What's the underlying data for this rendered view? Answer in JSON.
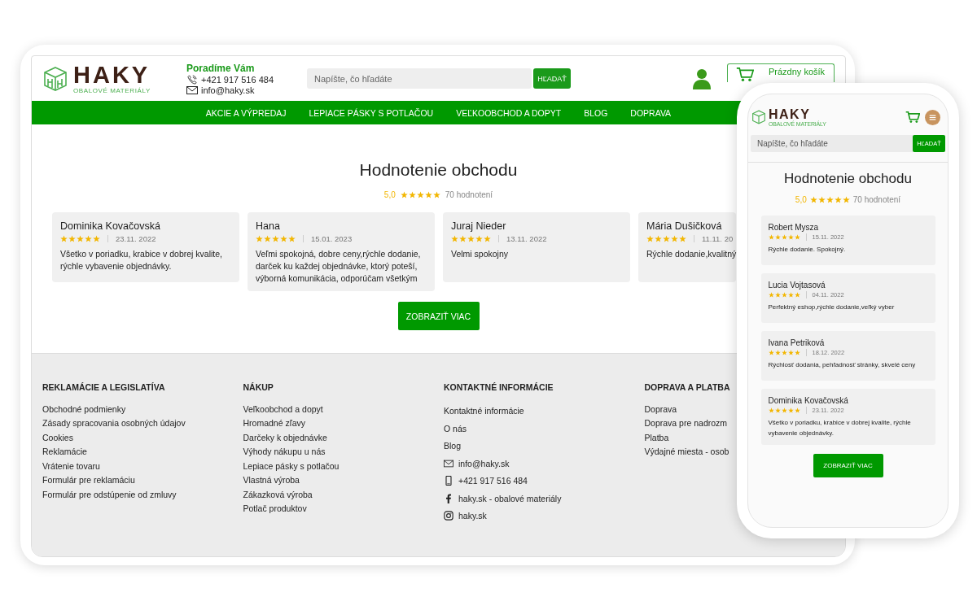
{
  "tablet": {
    "header": {
      "brand": "HAKY",
      "tagline": "OBALOVÉ MATERIÁLY",
      "help_title": "Poradíme Vám",
      "phone": "+421 917 516 484",
      "email": "info@haky.sk",
      "search_placeholder": "Napíšte, čo hľadáte",
      "search_button": "HĽADAŤ",
      "cart_label": "Prázdny košík"
    },
    "nav": [
      "AKCIE A VÝPREDAJ",
      "LEPIACE PÁSKY S POTLAČOU",
      "VEĽKOOBCHOD A DOPYT",
      "BLOG",
      "DOPRAVA"
    ],
    "reviews": {
      "title": "Hodnotenie obchodu",
      "score": "5,0",
      "stars": 5,
      "count": "70 hodnotení",
      "items": [
        {
          "name": "Dominika Kovačovská",
          "stars": 5,
          "date": "23.11. 2022",
          "text": "Všetko v poriadku, krabice v dobrej kvalite, rýchle vybavenie objednávky."
        },
        {
          "name": "Hana",
          "stars": 5,
          "date": "15.01. 2023",
          "text": "Veľmi spokojná, dobre ceny,rýchle dodanie, darček ku každej objednávke, ktorý poteší, výborná komunikácia, odporúčam všetkým"
        },
        {
          "name": "Juraj Nieder",
          "stars": 5,
          "date": "13.11. 2022",
          "text": "Velmi spokojny"
        },
        {
          "name": "Mária Dušičková",
          "stars": 5,
          "date": "11.11. 20",
          "text": "Rýchle dodanie,kvalitný"
        }
      ]
    },
    "more_button": "ZOBRAZIŤ VIAC",
    "footer": [
      {
        "heading": "REKLAMÁCIE A LEGISLATÍVA",
        "links": [
          {
            "kind": "plain",
            "text": "Obchodné podmienky"
          },
          {
            "kind": "plain",
            "text": "Zásady spracovania osobných údajov"
          },
          {
            "kind": "plain",
            "text": "Cookies"
          },
          {
            "kind": "plain",
            "text": "Reklamácie"
          },
          {
            "kind": "plain",
            "text": "Vrátenie tovaru"
          },
          {
            "kind": "plain",
            "text": "Formulár pre reklamáciu"
          },
          {
            "kind": "plain",
            "text": "Formulár pre odstúpenie od zmluvy"
          }
        ]
      },
      {
        "heading": "NÁKUP",
        "links": [
          {
            "kind": "plain",
            "text": "Veľkoobchod a dopyt"
          },
          {
            "kind": "plain",
            "text": "Hromadné zľavy"
          },
          {
            "kind": "plain",
            "text": "Darčeky k objednávke"
          },
          {
            "kind": "plain",
            "text": "Výhody nákupu u nás"
          },
          {
            "kind": "plain",
            "text": "Lepiace pásky s potlačou"
          },
          {
            "kind": "plain",
            "text": "Vlastná výroba"
          },
          {
            "kind": "plain",
            "text": "Zákazková výroba"
          },
          {
            "kind": "plain",
            "text": "Potlač produktov"
          }
        ]
      },
      {
        "heading": "KONTAKTNÉ INFORMÁCIE",
        "links": [
          {
            "kind": "contact",
            "text": "Kontaktné informácie"
          },
          {
            "kind": "contact",
            "text": "O nás"
          },
          {
            "kind": "contact",
            "text": "Blog"
          },
          {
            "kind": "email",
            "text": "info@haky.sk"
          },
          {
            "kind": "phone",
            "text": "+421 917 516 484"
          },
          {
            "kind": "facebook",
            "text": "haky.sk - obalové materiály"
          },
          {
            "kind": "instagram",
            "text": "haky.sk"
          }
        ]
      },
      {
        "heading": "DOPRAVA A PLATBA",
        "links": [
          {
            "kind": "plain",
            "text": "Doprava"
          },
          {
            "kind": "plain",
            "text": "Doprava pre nadrozm"
          },
          {
            "kind": "plain",
            "text": "Platba"
          },
          {
            "kind": "plain",
            "text": "Výdajné miesta - osob"
          }
        ]
      }
    ]
  },
  "phone": {
    "brand": "HAKY",
    "tagline": "OBALOVÉ MATERIÁLY",
    "search_placeholder": "Napíšte, čo hľadáte",
    "search_button": "HĽADAŤ",
    "title": "Hodnotenie obchodu",
    "score": "5,0",
    "stars": 5,
    "count": "70 hodnotení",
    "items": [
      {
        "name": "Robert Mysza",
        "stars": 5,
        "date": "15.11. 2022",
        "text": "Rýchle dodanie. Spokojný."
      },
      {
        "name": "Lucia Vojtasová",
        "stars": 5,
        "date": "04.11. 2022",
        "text": "Perfektný eshop,rýchle dodanie,veľký vyber"
      },
      {
        "name": "Ivana Petriková",
        "stars": 5,
        "date": "18.12. 2022",
        "text": "Rýchlosť dodania, pehľadnosť stránky, skvelé ceny"
      },
      {
        "name": "Dominika Kovačovská",
        "stars": 5,
        "date": "23.11. 2022",
        "text": "Všetko v poriadku, krabice v dobrej kvalite, rýchle vybavenie objednávky."
      }
    ],
    "more_button": "ZOBRAZIŤ VIAC"
  }
}
